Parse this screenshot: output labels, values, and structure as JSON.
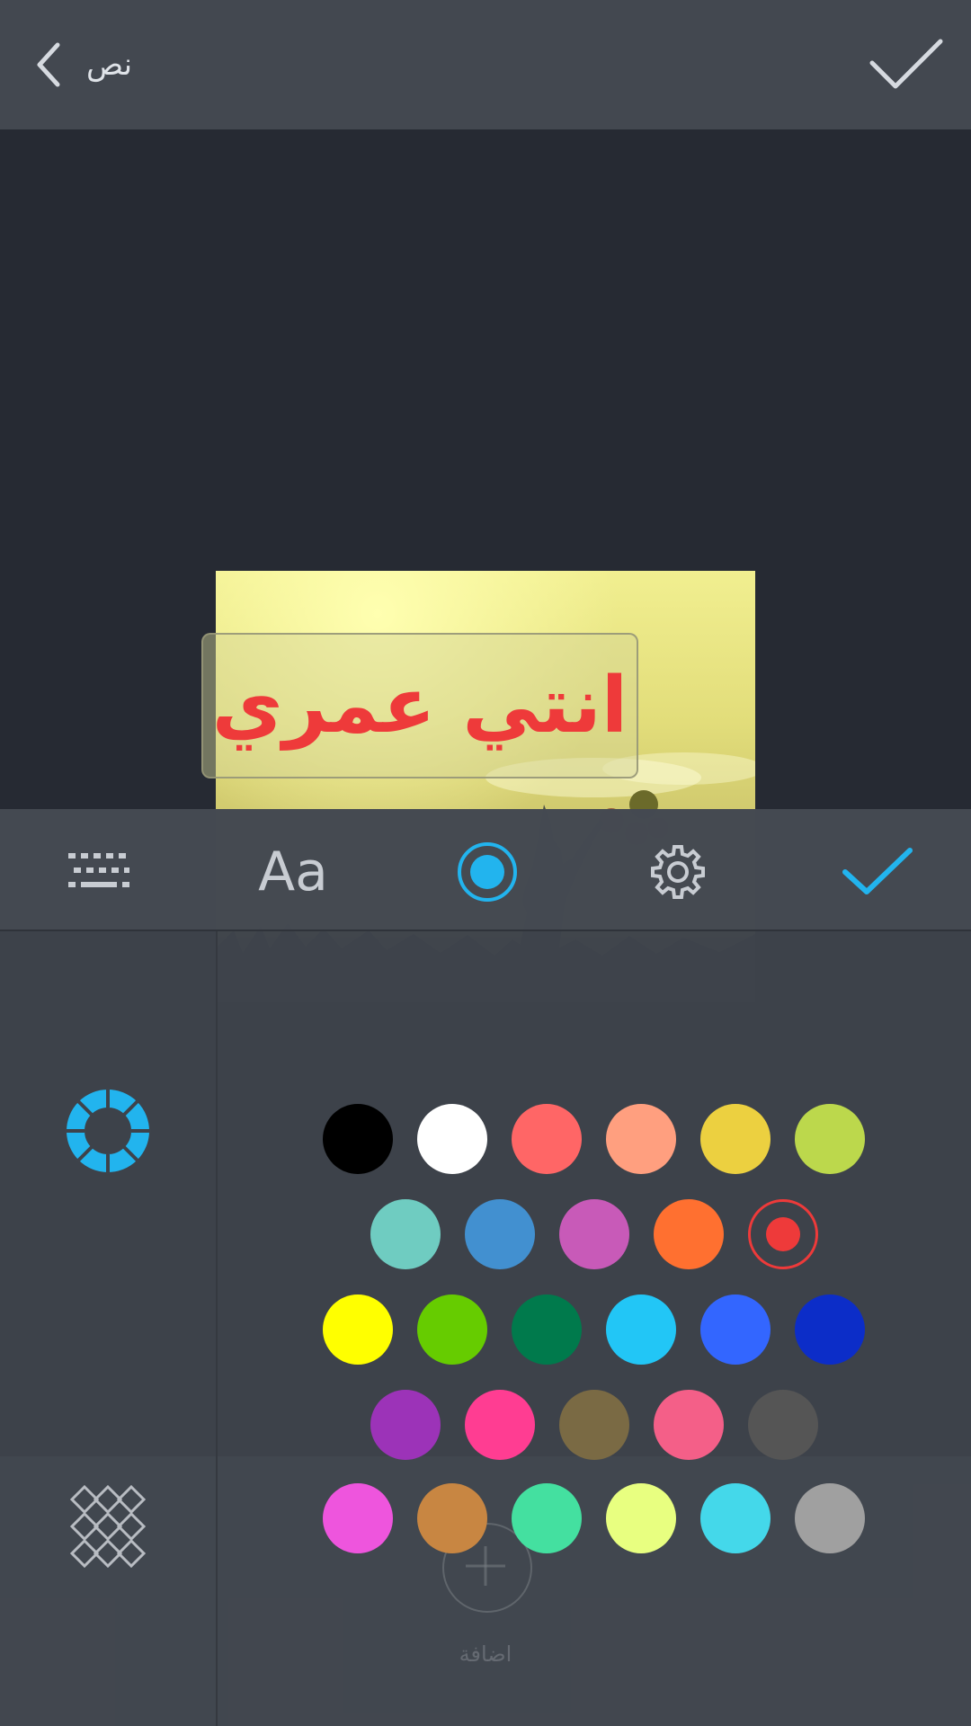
{
  "header": {
    "title": "نص"
  },
  "canvas": {
    "text": "انتي عمري",
    "text_color": "#ee3a3a"
  },
  "toolbar": {
    "font_label": "Aa"
  },
  "add": {
    "label": "اضافة"
  },
  "icons": {
    "back": "chevron-left-icon",
    "confirm": "checkmark-icon",
    "keyboard": "keyboard-icon",
    "color": "color-radio-icon",
    "settings": "gear-icon",
    "done": "checkmark-icon",
    "color_wheel": "color-wheel-icon",
    "pattern": "pattern-grid-icon",
    "add": "plus-icon"
  },
  "palette": {
    "selected": "#ee3a3a",
    "rows": [
      [
        "#000000",
        "#ffffff",
        "#ff6666",
        "#ff9f7f",
        "#ecd040",
        "#bcd84c"
      ],
      [
        "#6fccc1",
        "#4290d0",
        "#c85ab8",
        "#ff7030",
        "#ee3a3a"
      ],
      [
        "#ffff00",
        "#66cc00",
        "#007a4c",
        "#22c6f6",
        "#3366ff",
        "#0c2dc8"
      ],
      [
        "#9c33b8",
        "#ff3d92",
        "#7a6a44",
        "#f45f88",
        "#555555"
      ],
      [
        "#ee55dd",
        "#c88642",
        "#44e0a0",
        "#e8ff80",
        "#44d8ea",
        "#a0a0a0"
      ]
    ]
  }
}
